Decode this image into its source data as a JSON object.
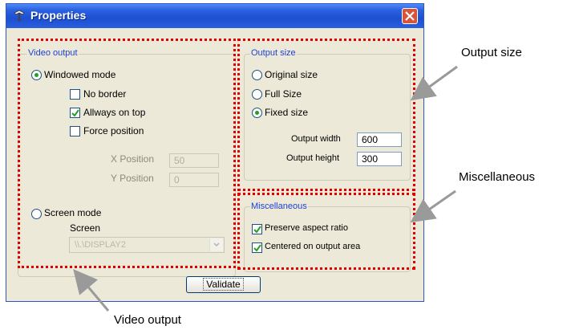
{
  "window": {
    "title": "Properties",
    "icons": {
      "app": "app-icon",
      "close": "close-icon"
    }
  },
  "video_output": {
    "group_title": "Video output",
    "windowed_mode": {
      "label": "Windowed mode",
      "selected": true
    },
    "no_border": {
      "label": "No border",
      "checked": false
    },
    "always_on_top": {
      "label": "Allways on top",
      "checked": true
    },
    "force_position": {
      "label": "Force position",
      "checked": false
    },
    "x_position": {
      "label": "X Position",
      "value": "50"
    },
    "y_position": {
      "label": "Y Position",
      "value": "0"
    },
    "screen_mode": {
      "label": "Screen mode",
      "selected": false
    },
    "screen": {
      "label": "Screen",
      "value": "\\\\.\\DISPLAY2"
    }
  },
  "output_size": {
    "group_title": "Output size",
    "original_size": {
      "label": "Original size",
      "selected": false
    },
    "full_size": {
      "label": "Full Size",
      "selected": false
    },
    "fixed_size": {
      "label": "Fixed size",
      "selected": true
    },
    "output_width": {
      "label": "Output width",
      "value": "600"
    },
    "output_height": {
      "label": "Output height",
      "value": "300"
    }
  },
  "miscellaneous": {
    "group_title": "Miscellaneous",
    "preserve_aspect": {
      "label": "Preserve aspect ratio",
      "checked": true
    },
    "centered": {
      "label": "Centered on output area",
      "checked": true
    }
  },
  "buttons": {
    "validate": "Validate"
  },
  "callouts": {
    "output_size": "Output size",
    "miscellaneous": "Miscellaneous",
    "video_output": "Video output"
  },
  "colors": {
    "highlight_border": "#e00000",
    "group_title": "#1f3fd8",
    "title_bar": "#2a62e0"
  }
}
